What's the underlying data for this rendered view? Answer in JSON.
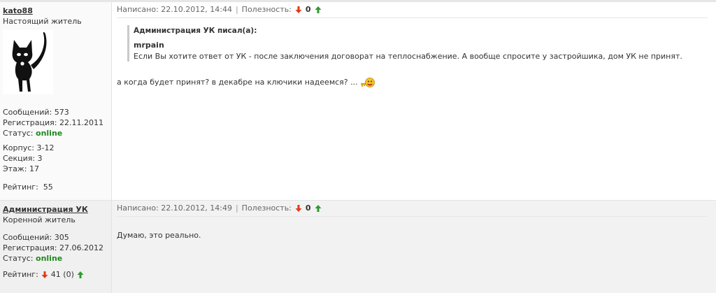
{
  "posts": [
    {
      "author": {
        "username": "kato88",
        "rank": "Настоящий житель",
        "messages": "Сообщений: 573",
        "registered": "Регистрация: 22.11.2011",
        "status_label": "Статус:",
        "status": "online",
        "building": "Корпус: 3-12",
        "section": "Секция: 3",
        "floor": "Этаж: 17",
        "rating_label": "Рейтинг:",
        "rating": "55"
      },
      "meta": {
        "written": "Написано: 22.10.2012, 14:44",
        "separator": "|",
        "usefulness_label": "Полезность:",
        "usefulness": "0"
      },
      "quote": {
        "header": "Администрация УК писал(а):",
        "author": "mrpain",
        "text": "Если Вы хотите ответ от УК - после заключения договорат на теплоснабжение. А вообще спросите у застройшика, дом УК не принят."
      },
      "message": "а когда будет принят? в декабре на ключики надеемся? ..."
    },
    {
      "author": {
        "username": "Администрация УК",
        "rank": "Коренной житель",
        "messages": "Сообщений: 305",
        "registered": "Регистрация: 27.06.2012",
        "status_label": "Статус:",
        "status": "online",
        "rating_label": "Рейтинг:",
        "rating": "41 (0)"
      },
      "meta": {
        "written": "Написано: 22.10.2012, 14:49",
        "separator": "|",
        "usefulness_label": "Полезность:",
        "usefulness": "0"
      },
      "message": "Думаю, это реально."
    }
  ],
  "icons": {
    "down_arrow": "red-down-arrow-icon",
    "up_arrow": "green-up-arrow-icon",
    "avatar": "black-cat-avatar",
    "smiley": "key-smiley-icon"
  },
  "colors": {
    "status_online": "#1f8a1f",
    "arrow_down": "#e23a1a",
    "arrow_up": "#2e9a2e"
  }
}
